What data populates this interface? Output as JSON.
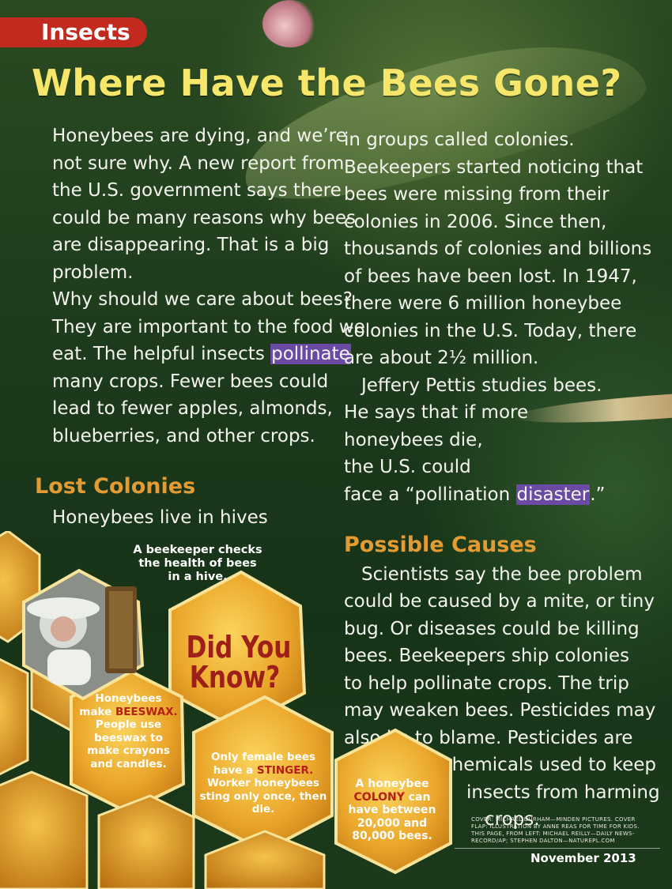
{
  "section_tag": "Insects",
  "title": "Where Have the Bees Gone?",
  "column1": {
    "p1": [
      "Honeybees are dying, and we’re",
      "not sure why. A new report from",
      "the U.S. government says there",
      "could be many reasons why bees",
      "are disappearing. That is a big",
      "problem."
    ],
    "p2a": [
      "Why should we care about bees?",
      "They are important to the food we",
      "eat. The helpful insects "
    ],
    "p2_highlight": "pollinate",
    "p2b": [
      "many crops. Fewer bees could",
      "lead to fewer apples, almonds,",
      "blueberries, and other crops."
    ],
    "subhead": "Lost Colonies",
    "p3": "Honeybees live in hives"
  },
  "column2": {
    "p1": [
      "in groups called colonies.",
      "Beekeepers started noticing that",
      "bees were missing from their",
      "colonies in 2006. Since then,",
      "thousands of colonies and billions",
      "of bees have been lost. In 1947,",
      "there were 6 million honeybee",
      "colonies in the U.S. Today, there",
      "are about 2½ million."
    ],
    "p2": [
      "Jeffery Pettis studies bees.",
      "He says that if more",
      "honeybees die,",
      "the U.S. could"
    ],
    "p2_last_before": "face a “pollination ",
    "p2_highlight": "disaster",
    "p2_last_after": ".”",
    "subhead": "Possible Causes",
    "p3": [
      "Scientists say the bee problem",
      "could be caused by a mite, or tiny",
      "bug. Or diseases could be killing",
      "bees. Beekeepers ship colonies",
      "to help pollinate crops. The trip",
      "may weaken bees. Pesticides may",
      "also be to blame. Pesticides are"
    ],
    "p3_indented": [
      "chemicals used to keep",
      "insects from harming",
      "crops."
    ]
  },
  "sidebar": {
    "photo_caption": [
      "A beekeeper checks",
      "the health of bees",
      "in a hive."
    ],
    "heading": [
      "Did You",
      "Know?"
    ],
    "fact1": {
      "before": "Honeybees make",
      "highlight": "BEESWAX.",
      "after": "People use beeswax to make crayons and candles."
    },
    "fact2": {
      "before": "Only female bees have a",
      "highlight": "STINGER.",
      "after": "Worker honeybees sting only once, then die."
    },
    "fact3": {
      "before": "A honeybee",
      "highlight": "COLONY",
      "after": "can have between 20,000 and 80,000 bees."
    }
  },
  "credits": "COVER: MICHAEL DURHAM—MINDEN PICTURES. COVER FLAP: ILLUSTRATION BY ANNE REAS FOR TIME FOR KIDS. THIS PAGE, FROM LEFT: MICHAEL REILLY—DAILY NEWS-RECORD/AP; STEPHEN DALTON—NATUREPL.COM",
  "date": "November 2013",
  "colors": {
    "title": "#f6e66a",
    "tag": "#c22a20",
    "subhead": "#e39b33",
    "highlight": "#6b4aa6",
    "fact_red": "#b61e16"
  }
}
